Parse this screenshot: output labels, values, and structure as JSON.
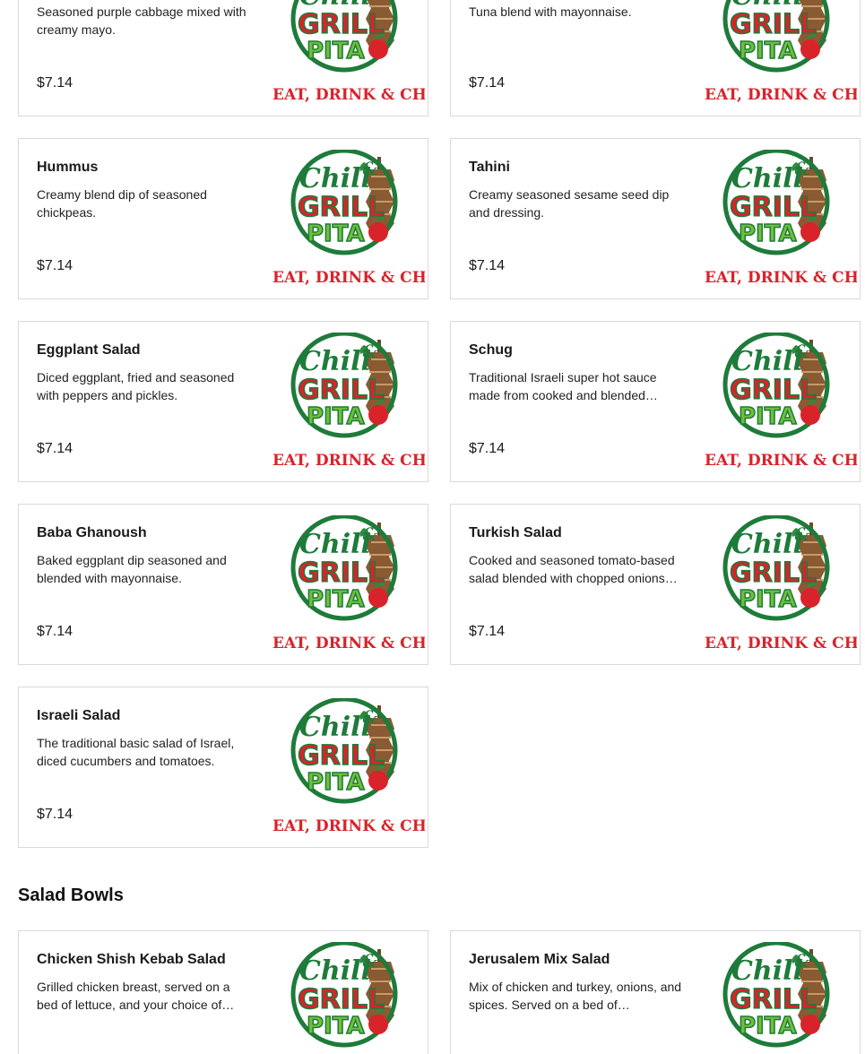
{
  "brand": {
    "logo_top_1": "Chill",
    "logo_amp": "&",
    "logo_top_2": "GRILL",
    "logo_top_3": "PITA",
    "tagline": "EAT, DRINK & CHILL",
    "colors": {
      "green": "#1e7b3a",
      "red": "#d8232a",
      "brown": "#8a5a33"
    }
  },
  "items_top": [
    {
      "name": "",
      "desc": "Seasoned purple cabbage mixed with creamy mayo.",
      "price": "$7.14"
    },
    {
      "name": "",
      "desc": "Tuna blend with mayonnaise.",
      "price": "$7.14"
    },
    {
      "name": "Hummus",
      "desc": "Creamy blend dip of seasoned chickpeas.",
      "price": "$7.14"
    },
    {
      "name": "Tahini",
      "desc": "Creamy seasoned sesame seed dip and dressing.",
      "price": "$7.14"
    },
    {
      "name": "Eggplant Salad",
      "desc": "Diced eggplant, fried and seasoned with peppers and pickles.",
      "price": "$7.14"
    },
    {
      "name": "Schug",
      "desc": "Traditional Israeli super hot sauce made from cooked and blended…",
      "price": "$7.14"
    },
    {
      "name": "Baba Ghanoush",
      "desc": "Baked eggplant dip seasoned and blended with mayonnaise.",
      "price": "$7.14"
    },
    {
      "name": "Turkish Salad",
      "desc": "Cooked and seasoned tomato-based salad blended with chopped onions…",
      "price": "$7.14"
    },
    {
      "name": "Israeli Salad",
      "desc": "The traditional basic salad of Israel, diced cucumbers and tomatoes.",
      "price": "$7.14"
    }
  ],
  "salad_bowls": {
    "title": "Salad Bowls",
    "items": [
      {
        "name": "Chicken Shish Kebab Salad",
        "desc": "Grilled chicken breast, served on a bed of lettuce, and your choice of…"
      },
      {
        "name": "Jerusalem Mix Salad",
        "desc": "Mix of chicken and turkey, onions, and spices. Served on a bed of…"
      }
    ]
  }
}
